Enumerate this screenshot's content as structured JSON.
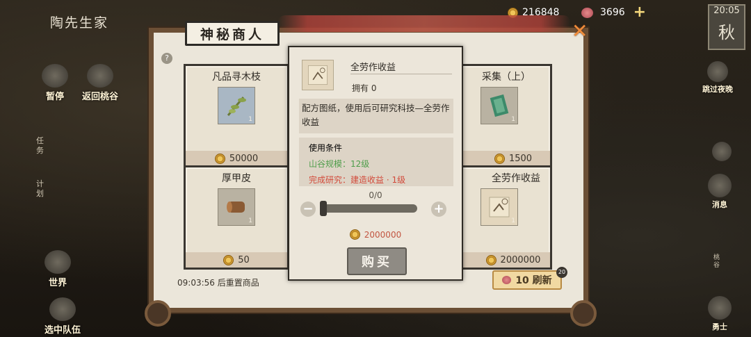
{
  "game_title": "陶先生家",
  "currency": {
    "coins": "216848",
    "gems": "3696"
  },
  "clock": {
    "time": "20:05",
    "season": "秋"
  },
  "left_nav": {
    "pause": "暂停",
    "return": "返回桃谷",
    "task": "任务",
    "plan": "计划",
    "world": "世界",
    "team": "选中队伍"
  },
  "right_nav": {
    "skip_night": "跳过夜晚",
    "message": "消息",
    "taogu": "桃谷",
    "warrior": "勇士"
  },
  "shop": {
    "title": "神秘商人",
    "reset_text": "09:03:56 后重置商品",
    "refresh_label": "10 刷新",
    "refresh_badge": "20",
    "items": [
      {
        "name": "凡品寻木枝",
        "qty": "1",
        "price": "50000",
        "icon": "branch-icon"
      },
      {
        "name": "厚甲皮",
        "qty": "1",
        "price": "50",
        "icon": "leather-roll-icon"
      },
      {
        "name": "采集（上）",
        "qty": "1",
        "price": "1500",
        "icon": "scroll-book-icon"
      },
      {
        "name": "全劳作收益",
        "qty": "1",
        "price": "2000000",
        "icon": "recipe-paper-icon"
      }
    ]
  },
  "detail": {
    "title": "全劳作收益",
    "owned": "拥有 0",
    "description": "配方图纸，使用后可研究科技—全劳作收益",
    "conditions_label": "使用条件",
    "condition_1": "山谷规模：12级",
    "condition_2": "完成研究：建造收益 · 1级",
    "counter": "0/0",
    "price": "2000000",
    "buy_label": "购买"
  }
}
